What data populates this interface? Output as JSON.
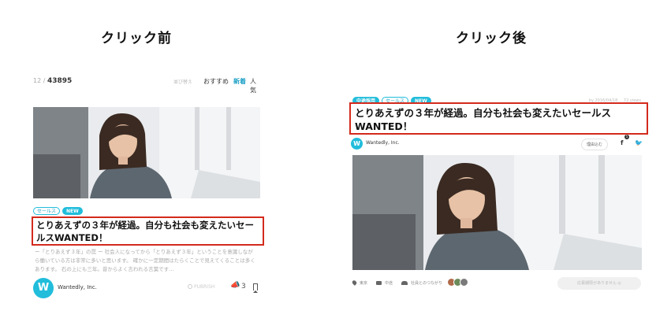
{
  "headings": {
    "before": "クリック前",
    "after": "クリック後"
  },
  "left": {
    "count_prefix": "12 /",
    "count_total": "43895",
    "sort_label": "並び替え",
    "sort_options": [
      "おすすめ",
      "新着",
      "人気"
    ],
    "active_sort": "新着",
    "tags": [
      "セールス",
      "NEW"
    ],
    "title": "とりあえずの３年が経過。自分も社会も変えたいセールスWANTED！",
    "description": "ー「とりあえず３年」の罠 ー 社会人になってから「とりあえず３年」ということを意識しながら働いている方は非常に多いと思います。 確かに一定期間はたらくことで見えてくることは多くあります。 石の上にも三年。昔からよく言われる言葉です…",
    "company": "Wantedly, Inc.",
    "logo_letter": "W",
    "date": "PUBRISH",
    "cheer_count": "3"
  },
  "right": {
    "tags": [
      "中途採用",
      "セールス",
      "NEW"
    ],
    "meta_date": "by 2016/04/18",
    "meta_views": "72 views",
    "title": "とりあえずの３年が経過。自分も社会も変えたいセールスWANTED！",
    "company": "Wantedly, Inc.",
    "logo_letter": "W",
    "report_label": "理由込む",
    "fb_label": "f",
    "fb_badge": "5",
    "tw_label": "🐦",
    "location": "東京",
    "job_type": "中途",
    "connections": "社員とのつながり",
    "apply_label": "応募期限がありません ◎"
  },
  "colors": {
    "accent": "#21bddb",
    "highlight_border": "#d32a1c"
  }
}
